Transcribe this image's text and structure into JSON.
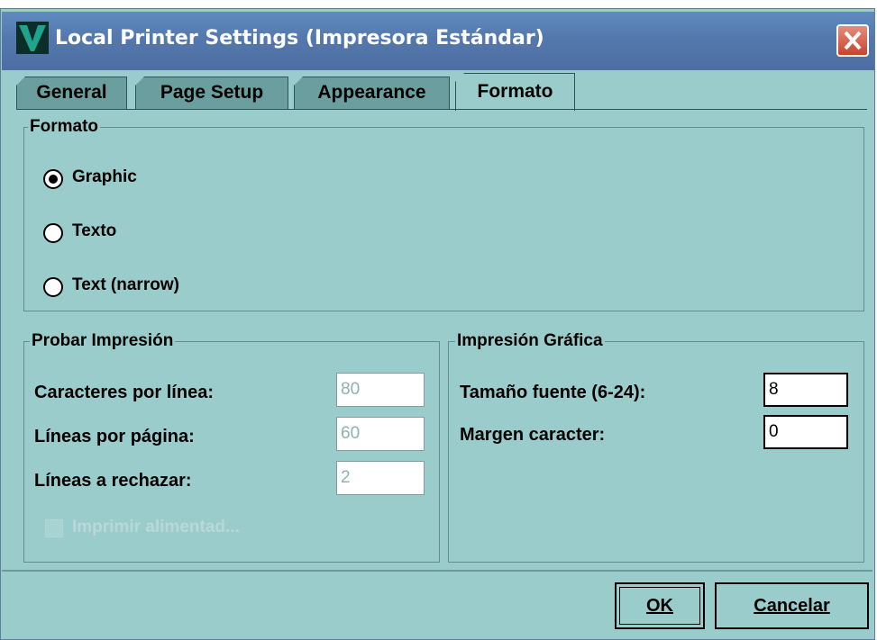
{
  "window": {
    "title": "Local Printer Settings (Impresora Estándar)"
  },
  "tabs": [
    {
      "label": "General"
    },
    {
      "label": "Page Setup"
    },
    {
      "label": "Appearance"
    },
    {
      "label": "Formato",
      "selected": true
    }
  ],
  "formato_group": {
    "title": "Formato",
    "options": [
      {
        "label": "Graphic",
        "selected": true
      },
      {
        "label": "Texto",
        "selected": false
      },
      {
        "label": "Text (narrow)",
        "selected": false
      }
    ]
  },
  "probar_group": {
    "title": "Probar Impresión",
    "fields": [
      {
        "label": "Caracteres por línea:",
        "value": "80"
      },
      {
        "label": "Líneas por página:",
        "value": "60"
      },
      {
        "label": "Líneas a rechazar:",
        "value": "2"
      }
    ],
    "checkbox_label": "Imprimir alimentad...",
    "checkbox_checked": false
  },
  "grafica_group": {
    "title": "Impresión Gráfica",
    "fields": [
      {
        "label": "Tamaño fuente (6-24):",
        "value": "8"
      },
      {
        "label": "Margen caracter:",
        "value": "0"
      }
    ]
  },
  "buttons": {
    "ok": "OK",
    "cancel": "Cancelar"
  },
  "colors": {
    "dialog_bg": "#9bcccc",
    "titlebar": "#5478ad",
    "tab_inactive": "#6b9f9f"
  }
}
